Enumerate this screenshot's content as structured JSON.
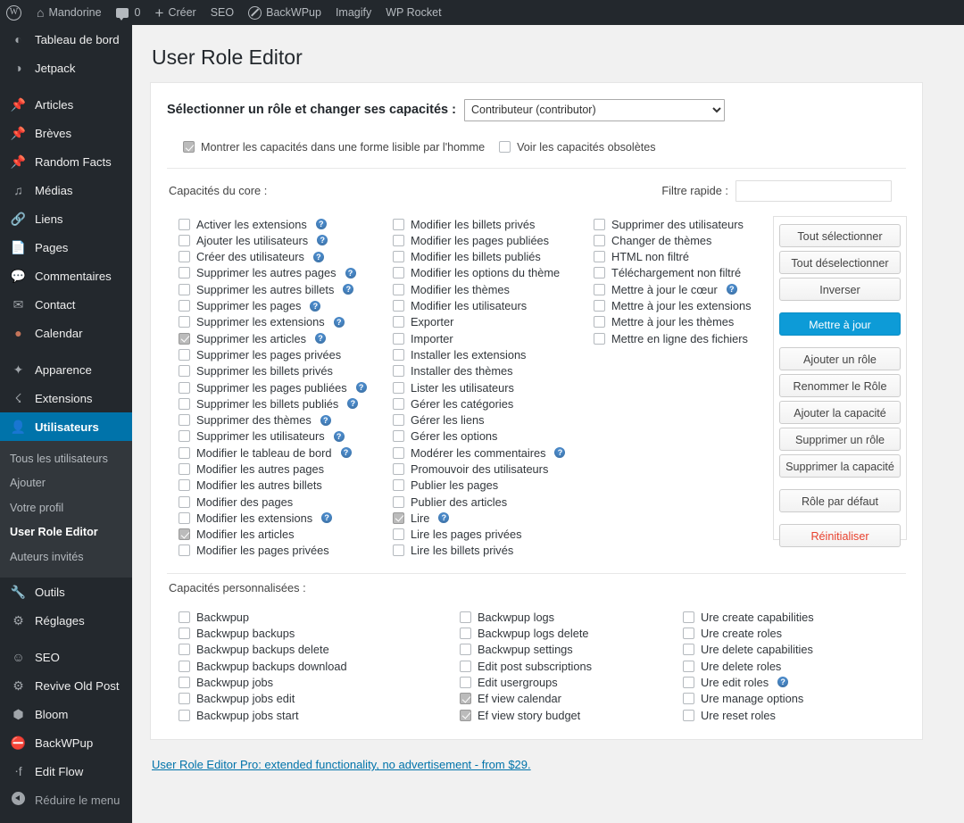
{
  "adminbar": {
    "logo_icon": "wordpress-logo-icon",
    "site_name": "Mandorine",
    "comment_count": "0",
    "create_label": "Créer",
    "items": [
      {
        "label": "SEO"
      },
      {
        "label": "BackWPup"
      },
      {
        "label": "Imagify"
      },
      {
        "label": "WP Rocket"
      }
    ]
  },
  "sidebar": {
    "items": [
      {
        "label": "Tableau de bord",
        "icon": "dashboard-icon"
      },
      {
        "label": "Jetpack",
        "icon": "jetpack-icon"
      },
      {
        "label": "Articles",
        "icon": "pin-icon"
      },
      {
        "label": "Brèves",
        "icon": "pin-icon"
      },
      {
        "label": "Random Facts",
        "icon": "pin-icon"
      },
      {
        "label": "Médias",
        "icon": "media-icon"
      },
      {
        "label": "Liens",
        "icon": "link-icon"
      },
      {
        "label": "Pages",
        "icon": "pages-icon"
      },
      {
        "label": "Commentaires",
        "icon": "comment-icon"
      },
      {
        "label": "Contact",
        "icon": "envelope-icon"
      },
      {
        "label": "Calendar",
        "icon": "calendar-icon"
      },
      {
        "label": "Apparence",
        "icon": "brush-icon"
      },
      {
        "label": "Extensions",
        "icon": "plug-icon"
      },
      {
        "label": "Utilisateurs",
        "icon": "user-icon"
      },
      {
        "label": "Outils",
        "icon": "wrench-icon"
      },
      {
        "label": "Réglages",
        "icon": "settings-icon"
      },
      {
        "label": "SEO",
        "icon": "seo-icon"
      },
      {
        "label": "Revive Old Post",
        "icon": "gear-icon"
      },
      {
        "label": "Bloom",
        "icon": "bloom-icon"
      },
      {
        "label": "BackWPup",
        "icon": "backwpup-icon"
      },
      {
        "label": "Edit Flow",
        "icon": "editflow-icon"
      }
    ],
    "submenu": [
      {
        "label": "Tous les utilisateurs"
      },
      {
        "label": "Ajouter"
      },
      {
        "label": "Votre profil"
      },
      {
        "label": "User Role Editor"
      },
      {
        "label": "Auteurs invités"
      }
    ],
    "collapse_label": "Réduire le menu",
    "active_item": "Utilisateurs",
    "active_subitem": "User Role Editor",
    "accent_color": "#0073aa"
  },
  "page": {
    "title": "User Role Editor",
    "role_label": "Sélectionner un rôle et changer ses capacités :",
    "selected_role": "Contributeur (contributor)",
    "role_options": [
      "Contributeur (contributor)"
    ],
    "option_human_readable": "Montrer les capacités dans une forme lisible par l'homme",
    "option_deprecated": "Voir les capacités obsolètes",
    "core_caps_title": "Capacités du core :",
    "filter_label": "Filtre rapide :",
    "filter_value": "",
    "custom_caps_title": "Capacités personnalisées :",
    "pro_link": "User Role Editor Pro: extended functionality, no advertisement - from $29."
  },
  "core_caps": {
    "col1": [
      {
        "label": "Activer les extensions",
        "checked": false,
        "help": true
      },
      {
        "label": "Ajouter les utilisateurs",
        "checked": false,
        "help": true
      },
      {
        "label": "Créer des utilisateurs",
        "checked": false,
        "help": true
      },
      {
        "label": "Supprimer les autres pages",
        "checked": false,
        "help": true
      },
      {
        "label": "Supprimer les autres billets",
        "checked": false,
        "help": true
      },
      {
        "label": "Supprimer les pages",
        "checked": false,
        "help": true
      },
      {
        "label": "Supprimer les extensions",
        "checked": false,
        "help": true
      },
      {
        "label": "Supprimer les articles",
        "checked": true,
        "help": true
      },
      {
        "label": "Supprimer les pages privées",
        "checked": false,
        "help": false
      },
      {
        "label": "Supprimer les billets privés",
        "checked": false,
        "help": false
      },
      {
        "label": "Supprimer les pages publiées",
        "checked": false,
        "help": true
      },
      {
        "label": "Supprimer les billets publiés",
        "checked": false,
        "help": true
      },
      {
        "label": "Supprimer des thèmes",
        "checked": false,
        "help": true
      },
      {
        "label": "Supprimer les utilisateurs",
        "checked": false,
        "help": true
      },
      {
        "label": "Modifier le tableau de bord",
        "checked": false,
        "help": true
      },
      {
        "label": "Modifier les autres pages",
        "checked": false,
        "help": false
      },
      {
        "label": "Modifier les autres billets",
        "checked": false,
        "help": false
      },
      {
        "label": "Modifier des pages",
        "checked": false,
        "help": false
      },
      {
        "label": "Modifier les extensions",
        "checked": false,
        "help": true
      },
      {
        "label": "Modifier les articles",
        "checked": true,
        "help": false
      },
      {
        "label": "Modifier les pages privées",
        "checked": false,
        "help": false
      }
    ],
    "col2": [
      {
        "label": "Modifier les billets privés",
        "checked": false,
        "help": false
      },
      {
        "label": "Modifier les pages publiées",
        "checked": false,
        "help": false
      },
      {
        "label": "Modifier les billets publiés",
        "checked": false,
        "help": false
      },
      {
        "label": "Modifier les options du thème",
        "checked": false,
        "help": false
      },
      {
        "label": "Modifier les thèmes",
        "checked": false,
        "help": false
      },
      {
        "label": "Modifier les utilisateurs",
        "checked": false,
        "help": false
      },
      {
        "label": "Exporter",
        "checked": false,
        "help": false
      },
      {
        "label": "Importer",
        "checked": false,
        "help": false
      },
      {
        "label": "Installer les extensions",
        "checked": false,
        "help": false
      },
      {
        "label": "Installer des thèmes",
        "checked": false,
        "help": false
      },
      {
        "label": "Lister les utilisateurs",
        "checked": false,
        "help": false
      },
      {
        "label": "Gérer les catégories",
        "checked": false,
        "help": false
      },
      {
        "label": "Gérer les liens",
        "checked": false,
        "help": false
      },
      {
        "label": "Gérer les options",
        "checked": false,
        "help": false
      },
      {
        "label": "Modérer les commentaires",
        "checked": false,
        "help": true
      },
      {
        "label": "Promouvoir des utilisateurs",
        "checked": false,
        "help": false
      },
      {
        "label": "Publier les pages",
        "checked": false,
        "help": false
      },
      {
        "label": "Publier des articles",
        "checked": false,
        "help": false
      },
      {
        "label": "Lire",
        "checked": true,
        "help": true
      },
      {
        "label": "Lire les pages privées",
        "checked": false,
        "help": false
      },
      {
        "label": "Lire les billets privés",
        "checked": false,
        "help": false
      }
    ],
    "col3": [
      {
        "label": "Supprimer des utilisateurs",
        "checked": false,
        "help": false
      },
      {
        "label": "Changer de thèmes",
        "checked": false,
        "help": false
      },
      {
        "label": "HTML non filtré",
        "checked": false,
        "help": false
      },
      {
        "label": "Téléchargement non filtré",
        "checked": false,
        "help": false
      },
      {
        "label": "Mettre à jour le cœur",
        "checked": false,
        "help": true
      },
      {
        "label": "Mettre à jour les extensions",
        "checked": false,
        "help": false
      },
      {
        "label": "Mettre à jour les thèmes",
        "checked": false,
        "help": false
      },
      {
        "label": "Mettre en ligne des fichiers",
        "checked": false,
        "help": false
      }
    ]
  },
  "custom_caps": {
    "col1": [
      {
        "label": "Backwpup",
        "checked": false,
        "help": false
      },
      {
        "label": "Backwpup backups",
        "checked": false,
        "help": false
      },
      {
        "label": "Backwpup backups delete",
        "checked": false,
        "help": false
      },
      {
        "label": "Backwpup backups download",
        "checked": false,
        "help": false
      },
      {
        "label": "Backwpup jobs",
        "checked": false,
        "help": false
      },
      {
        "label": "Backwpup jobs edit",
        "checked": false,
        "help": false
      },
      {
        "label": "Backwpup jobs start",
        "checked": false,
        "help": false
      }
    ],
    "col2": [
      {
        "label": "Backwpup logs",
        "checked": false,
        "help": false
      },
      {
        "label": "Backwpup logs delete",
        "checked": false,
        "help": false
      },
      {
        "label": "Backwpup settings",
        "checked": false,
        "help": false
      },
      {
        "label": "Edit post subscriptions",
        "checked": false,
        "help": false
      },
      {
        "label": "Edit usergroups",
        "checked": false,
        "help": false
      },
      {
        "label": "Ef view calendar",
        "checked": true,
        "help": false
      },
      {
        "label": "Ef view story budget",
        "checked": true,
        "help": false
      }
    ],
    "col3": [
      {
        "label": "Ure create capabilities",
        "checked": false,
        "help": false
      },
      {
        "label": "Ure create roles",
        "checked": false,
        "help": false
      },
      {
        "label": "Ure delete capabilities",
        "checked": false,
        "help": false
      },
      {
        "label": "Ure delete roles",
        "checked": false,
        "help": false
      },
      {
        "label": "Ure edit roles",
        "checked": false,
        "help": true
      },
      {
        "label": "Ure manage options",
        "checked": false,
        "help": false
      },
      {
        "label": "Ure reset roles",
        "checked": false,
        "help": false
      }
    ]
  },
  "buttons": {
    "group1": [
      {
        "label": "Tout sélectionner",
        "style": "default"
      },
      {
        "label": "Tout déselectionner",
        "style": "default"
      },
      {
        "label": "Inverser",
        "style": "default"
      }
    ],
    "group2": [
      {
        "label": "Mettre à jour",
        "style": "primary"
      }
    ],
    "group3": [
      {
        "label": "Ajouter un rôle",
        "style": "default"
      },
      {
        "label": "Renommer le Rôle",
        "style": "default"
      },
      {
        "label": "Ajouter la capacité",
        "style": "default"
      },
      {
        "label": "Supprimer un rôle",
        "style": "default"
      },
      {
        "label": "Supprimer la capacité",
        "style": "default"
      }
    ],
    "group4": [
      {
        "label": "Rôle par défaut",
        "style": "default"
      }
    ],
    "group5": [
      {
        "label": "Réinitialiser",
        "style": "danger"
      }
    ],
    "primary_color": "#0d9bd7",
    "danger_color": "#e8402d"
  }
}
